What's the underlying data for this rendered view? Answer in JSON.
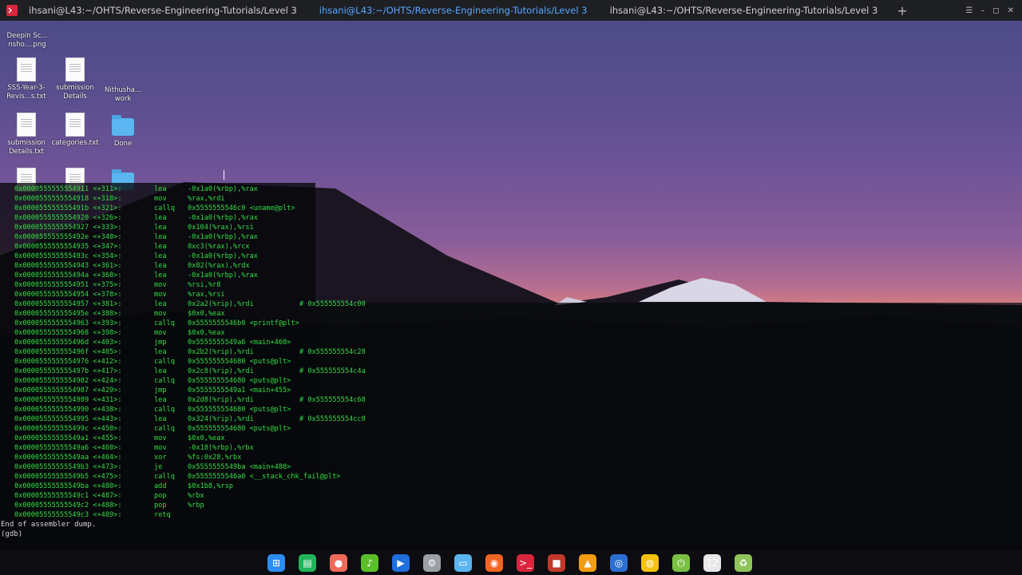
{
  "tabs": [
    {
      "label": "ihsani@L43:~/OHTS/Reverse-Engineering-Tutorials/Level 3",
      "active": false
    },
    {
      "label": "ihsani@L43:~/OHTS/Reverse-Engineering-Tutorials/Level 3",
      "active": true
    },
    {
      "label": "ihsani@L43:~/OHTS/Reverse-Engineering-Tutorials/Level 3",
      "active": false
    }
  ],
  "window_controls": {
    "menu": "☰",
    "minimize": "–",
    "maximize": "◻",
    "close": "✕"
  },
  "new_tab": "+",
  "desktop": {
    "icons": [
      {
        "label": "Deepin Sc... nsho....png",
        "kind": "image"
      },
      {
        "label": "SSS-Year-3-Revis...s.txt",
        "kind": "doc"
      },
      {
        "label": "submission Details",
        "kind": "doc"
      },
      {
        "label": "Nithusha... work",
        "kind": "folder-hidden"
      },
      {
        "label": "submission Details.txt",
        "kind": "doc"
      },
      {
        "label": "categories.txt",
        "kind": "doc"
      },
      {
        "label": "Done",
        "kind": "folder"
      }
    ]
  },
  "terminal": {
    "lines": [
      {
        "addr": "0x0000555555554911 <+311>:",
        "op": "lea",
        "args": "-0x1a0(%rbp),%rax",
        "comment": ""
      },
      {
        "addr": "0x0000555555554918 <+318>:",
        "op": "mov",
        "args": "%rax,%rdi",
        "comment": ""
      },
      {
        "addr": "0x000055555555491b <+321>:",
        "op": "callq",
        "args": "0x5555555546c0 <uname@plt>",
        "comment": ""
      },
      {
        "addr": "0x0000555555554920 <+326>:",
        "op": "lea",
        "args": "-0x1a0(%rbp),%rax",
        "comment": ""
      },
      {
        "addr": "0x0000555555554927 <+333>:",
        "op": "lea",
        "args": "0x104(%rax),%rsi",
        "comment": ""
      },
      {
        "addr": "0x000055555555492e <+340>:",
        "op": "lea",
        "args": "-0x1a0(%rbp),%rax",
        "comment": ""
      },
      {
        "addr": "0x0000555555554935 <+347>:",
        "op": "lea",
        "args": "0xc3(%rax),%rcx",
        "comment": ""
      },
      {
        "addr": "0x000055555555493c <+354>:",
        "op": "lea",
        "args": "-0x1a0(%rbp),%rax",
        "comment": ""
      },
      {
        "addr": "0x0000555555554943 <+361>:",
        "op": "lea",
        "args": "0x82(%rax),%rdx",
        "comment": ""
      },
      {
        "addr": "0x000055555555494a <+368>:",
        "op": "lea",
        "args": "-0x1a0(%rbp),%rax",
        "comment": ""
      },
      {
        "addr": "0x0000555555554951 <+375>:",
        "op": "mov",
        "args": "%rsi,%r8",
        "comment": ""
      },
      {
        "addr": "0x0000555555554954 <+378>:",
        "op": "mov",
        "args": "%rax,%rsi",
        "comment": ""
      },
      {
        "addr": "0x0000555555554957 <+381>:",
        "op": "lea",
        "args": "0x2a2(%rip),%rdi",
        "comment": "# 0x555555554c00"
      },
      {
        "addr": "0x000055555555495e <+388>:",
        "op": "mov",
        "args": "$0x0,%eax",
        "comment": ""
      },
      {
        "addr": "0x0000555555554963 <+393>:",
        "op": "callq",
        "args": "0x5555555546b0 <printf@plt>",
        "comment": ""
      },
      {
        "addr": "0x0000555555554968 <+398>:",
        "op": "mov",
        "args": "$0x0,%eax",
        "comment": ""
      },
      {
        "addr": "0x000055555555496d <+403>:",
        "op": "jmp",
        "args": "0x5555555549a6 <main+460>",
        "comment": ""
      },
      {
        "addr": "0x000055555555496f <+405>:",
        "op": "lea",
        "args": "0x2b2(%rip),%rdi",
        "comment": "# 0x555555554c28"
      },
      {
        "addr": "0x0000555555554976 <+412>:",
        "op": "callq",
        "args": "0x555555554680 <puts@plt>",
        "comment": ""
      },
      {
        "addr": "0x000055555555497b <+417>:",
        "op": "lea",
        "args": "0x2c8(%rip),%rdi",
        "comment": "# 0x555555554c4a"
      },
      {
        "addr": "0x0000555555554982 <+424>:",
        "op": "callq",
        "args": "0x555555554680 <puts@plt>",
        "comment": ""
      },
      {
        "addr": "0x0000555555554987 <+429>:",
        "op": "jmp",
        "args": "0x5555555549a1 <main+455>",
        "comment": ""
      },
      {
        "addr": "0x0000555555554989 <+431>:",
        "op": "lea",
        "args": "0x2d8(%rip),%rdi",
        "comment": "# 0x555555554c68"
      },
      {
        "addr": "0x0000555555554990 <+438>:",
        "op": "callq",
        "args": "0x555555554680 <puts@plt>",
        "comment": ""
      },
      {
        "addr": "0x0000555555554995 <+443>:",
        "op": "lea",
        "args": "0x324(%rip),%rdi",
        "comment": "# 0x555555554cc0"
      },
      {
        "addr": "0x000055555555499c <+450>:",
        "op": "callq",
        "args": "0x555555554680 <puts@plt>",
        "comment": ""
      },
      {
        "addr": "0x00005555555549a1 <+455>:",
        "op": "mov",
        "args": "$0x0,%eax",
        "comment": ""
      },
      {
        "addr": "0x00005555555549a6 <+460>:",
        "op": "mov",
        "args": "-0x18(%rbp),%rbx",
        "comment": ""
      },
      {
        "addr": "0x00005555555549aa <+464>:",
        "op": "xor",
        "args": "%fs:0x28,%rbx",
        "comment": ""
      },
      {
        "addr": "0x00005555555549b3 <+473>:",
        "op": "je",
        "args": "0x5555555549ba <main+480>",
        "comment": ""
      },
      {
        "addr": "0x00005555555549b5 <+475>:",
        "op": "callq",
        "args": "0x5555555546a0 <__stack_chk_fail@plt>",
        "comment": ""
      },
      {
        "addr": "0x00005555555549ba <+480>:",
        "op": "add",
        "args": "$0x1b8,%rsp",
        "comment": ""
      },
      {
        "addr": "0x00005555555549c1 <+487>:",
        "op": "pop",
        "args": "%rbx",
        "comment": ""
      },
      {
        "addr": "0x00005555555549c2 <+488>:",
        "op": "pop",
        "args": "%rbp",
        "comment": ""
      },
      {
        "addr": "0x00005555555549c3 <+489>:",
        "op": "retq",
        "args": "",
        "comment": ""
      }
    ],
    "end_message": "End of assembler dump.",
    "prompt": "(gdb)"
  },
  "dock": {
    "items": [
      {
        "name": "launcher",
        "glyph": "⊞",
        "color": "#2d8cf0"
      },
      {
        "name": "spreadsheet",
        "glyph": "▤",
        "color": "#21b35b"
      },
      {
        "name": "screenshot",
        "glyph": "●",
        "color": "#f06a5a"
      },
      {
        "name": "music",
        "glyph": "♪",
        "color": "#5bbf2a"
      },
      {
        "name": "video",
        "glyph": "▶",
        "color": "#1f6fdd"
      },
      {
        "name": "settings",
        "glyph": "⚙",
        "color": "#9aa0a6"
      },
      {
        "name": "files",
        "glyph": "▭",
        "color": "#5ab5f0"
      },
      {
        "name": "browser",
        "glyph": "◉",
        "color": "#f26522"
      },
      {
        "name": "terminal",
        "glyph": ">_",
        "color": "#d7263d"
      },
      {
        "name": "recorder",
        "glyph": "■",
        "color": "#c0392b"
      },
      {
        "name": "vlc",
        "glyph": "▲",
        "color": "#f39c12"
      },
      {
        "name": "record",
        "glyph": "◎",
        "color": "#2c6fd1"
      },
      {
        "name": "chrome",
        "glyph": "◍",
        "color": "#f4c20d"
      },
      {
        "name": "power",
        "glyph": "⏻",
        "color": "#7bc043"
      },
      {
        "name": "clock",
        "glyph": "12",
        "color": "#e8e8e8"
      },
      {
        "name": "trash",
        "glyph": "♻",
        "color": "#8fc45a"
      }
    ]
  }
}
